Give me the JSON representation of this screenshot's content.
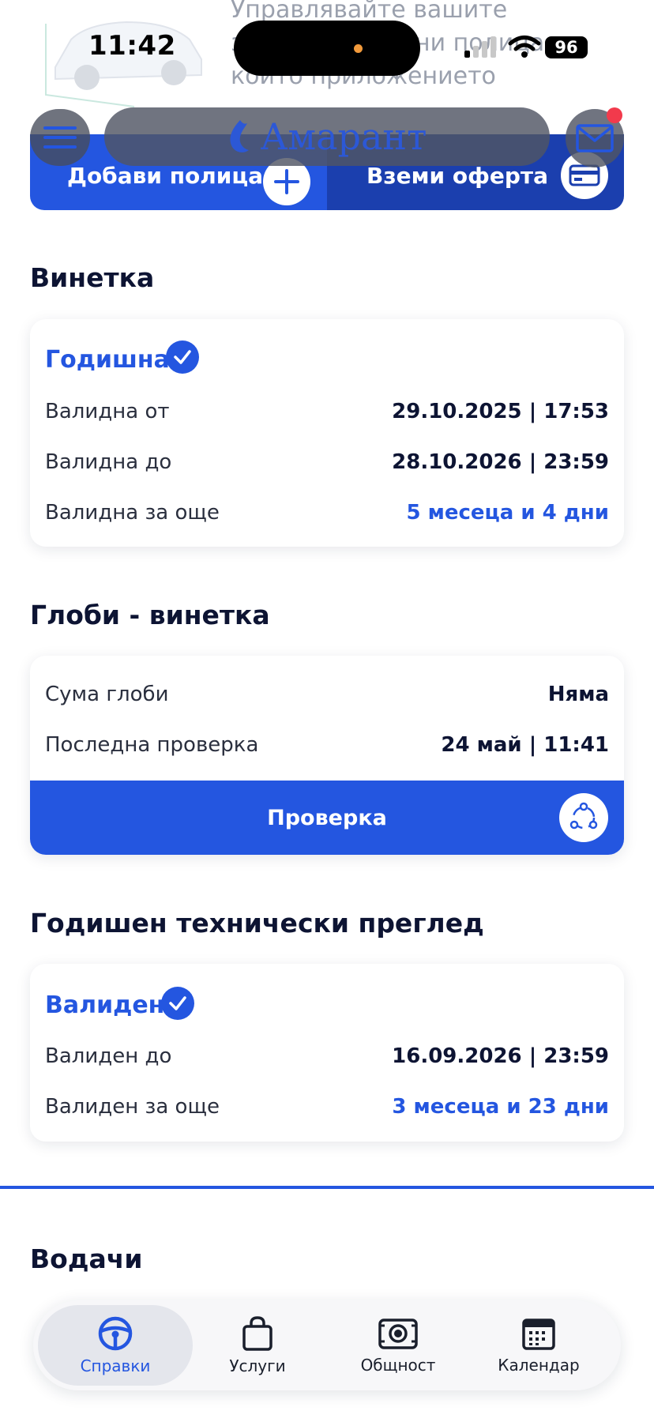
{
  "status_bar": {
    "time": "11:42",
    "battery": "96"
  },
  "banner": {
    "text": "Управлявайте вашите застрахователни полица, които приложението"
  },
  "header": {
    "logo": "Амарант"
  },
  "action_bar": {
    "add_policy": "Добави полица",
    "get_offer": "Вземи оферта"
  },
  "vignette": {
    "title": "Винетка",
    "status": "Годишна",
    "rows": [
      {
        "label": "Валидна от",
        "value": "29.10.2025 | 17:53"
      },
      {
        "label": "Валидна до",
        "value": "28.10.2026 | 23:59"
      },
      {
        "label": "Валидна за още",
        "value": "5 месеца и 4 дни"
      }
    ]
  },
  "fines": {
    "title": "Глоби - винетка",
    "rows": [
      {
        "label": "Сума глоби",
        "value": "Няма"
      },
      {
        "label": "Последна проверка",
        "value": "24 май | 11:41"
      }
    ],
    "check_button": "Проверка"
  },
  "inspection": {
    "title": "Годишен технически преглед",
    "status": "Валиден",
    "rows": [
      {
        "label": "Валиден до",
        "value": "16.09.2026 | 23:59"
      },
      {
        "label": "Валиден за още",
        "value": "3 месеца и 23 дни"
      }
    ]
  },
  "drivers": {
    "title": "Водачи"
  },
  "bottom_nav": {
    "items": [
      {
        "label": "Справки",
        "icon": "steering-wheel-icon",
        "active": true
      },
      {
        "label": "Услуги",
        "icon": "shopping-bag-icon",
        "active": false
      },
      {
        "label": "Общност",
        "icon": "camera-icon",
        "active": false
      },
      {
        "label": "Календар",
        "icon": "calendar-icon",
        "active": false
      }
    ]
  },
  "colors": {
    "accent": "#2456e0",
    "accent_dark": "#1b3fae",
    "text": "#0d1433",
    "notification": "#f23a4c"
  }
}
